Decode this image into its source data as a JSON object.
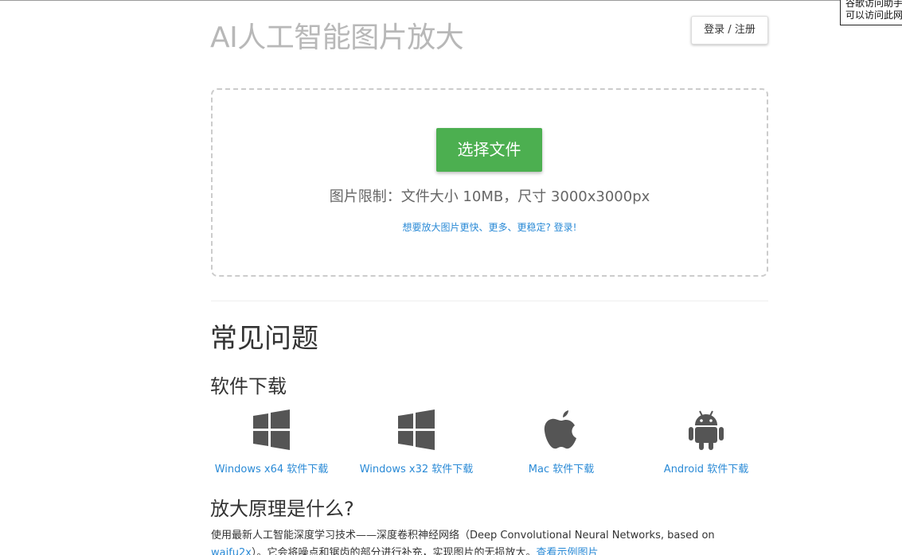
{
  "tooltip": {
    "line1": "谷歌访问助手",
    "line2": "可以访问此网"
  },
  "header": {
    "title": "AI人工智能图片放大",
    "login_label": "登录 / 注册"
  },
  "upload": {
    "choose_label": "选择文件",
    "limit_text": "图片限制：文件大小 10MB，尺寸 3000x3000px",
    "login_prompt": "想要放大图片更快、更多、更稳定? 登录!"
  },
  "faq": {
    "title": "常见问题",
    "download_title": "软件下载",
    "downloads": [
      {
        "label": "Windows x64 软件下载",
        "icon": "windows-icon"
      },
      {
        "label": "Windows x32 软件下载",
        "icon": "windows-icon"
      },
      {
        "label": "Mac 软件下载",
        "icon": "apple-icon"
      },
      {
        "label": "Android 软件下载",
        "icon": "android-icon"
      }
    ],
    "principle_title": "放大原理是什么?",
    "principle_text_1": "使用最新人工智能深度学习技术——深度卷积神经网络（Deep Convolutional Neural Networks, based on ",
    "principle_link": "waifu2x",
    "principle_text_2": "）。它会将噪点和锯齿的部分进行补充，实现图片的无损放大。",
    "example_link": "查看示例图片"
  },
  "colors": {
    "accent_green": "#4caf50",
    "link_blue": "#2a8ad6",
    "title_gray": "#b8b8b8",
    "icon_gray": "#555555"
  }
}
